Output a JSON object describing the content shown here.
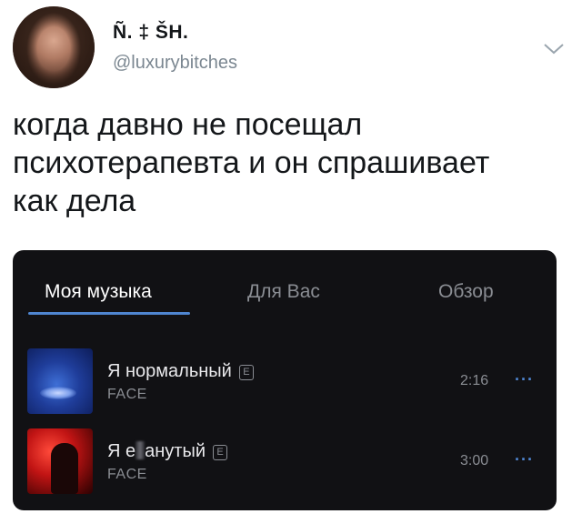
{
  "tweet": {
    "display_name": "Ñ. ‡ ŠH.",
    "handle": "@luxurybitches",
    "text_lines": [
      "когда давно не посещал",
      "психотерапевта и он спрашивает",
      "как дела"
    ]
  },
  "music_card": {
    "tabs": [
      {
        "label": "Моя музыка",
        "active": true
      },
      {
        "label": "Для Вас",
        "active": false
      },
      {
        "label": "Обзор",
        "active": false
      }
    ],
    "tracks": [
      {
        "title": "Я нормальный",
        "explicit_badge": "E",
        "artist": "FACE",
        "duration": "2:16",
        "more": "···"
      },
      {
        "title_start": "Я е",
        "title_end": "анутый",
        "explicit_badge": "E",
        "artist": "FACE",
        "duration": "3:00",
        "more": "···"
      }
    ],
    "colors": {
      "background": "#111114",
      "accent": "#4f86d1"
    }
  }
}
